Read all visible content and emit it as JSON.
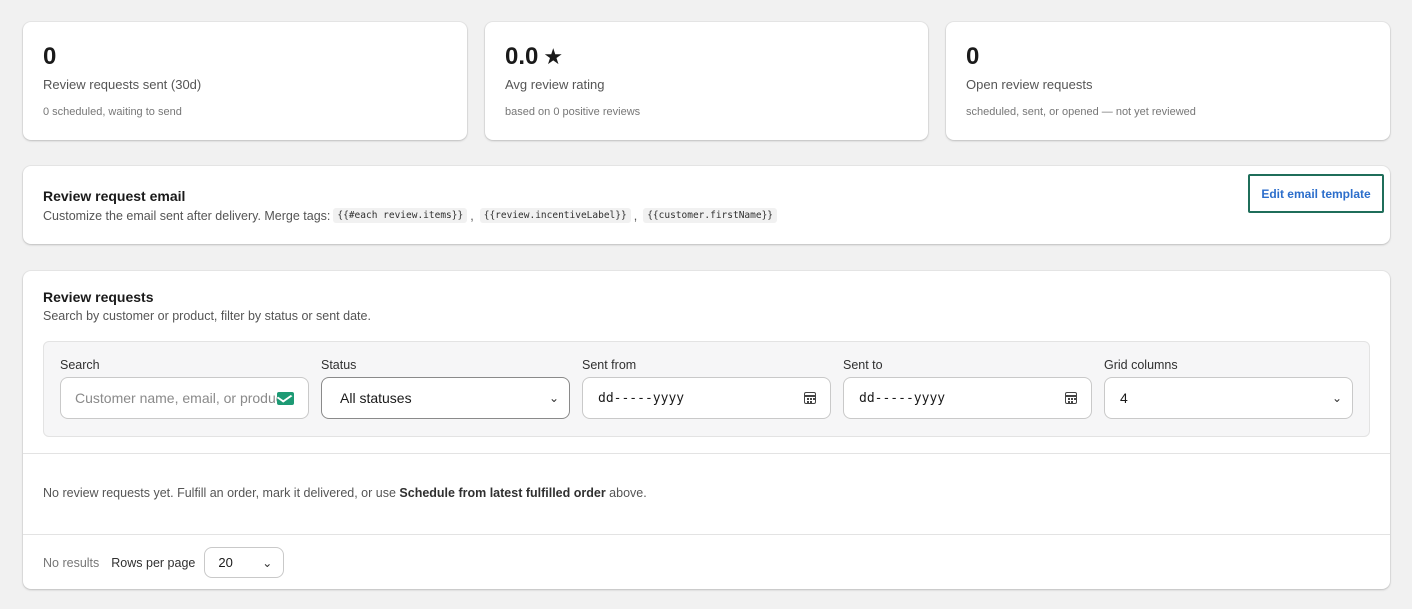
{
  "stats": [
    {
      "value": "0",
      "label": "Review requests sent (30d)",
      "sub": "0 scheduled, waiting to send"
    },
    {
      "value": "0.0",
      "label": "Avg review rating",
      "sub": "based on 0 positive reviews"
    },
    {
      "value": "0",
      "label": "Open review requests",
      "sub": "scheduled, sent, or opened — not yet reviewed"
    }
  ],
  "email": {
    "title": "Review request email",
    "desc": "Customize the email sent after delivery. Merge tags:",
    "tags": [
      "{{#each review.items}}",
      "{{review.incentiveLabel}}",
      "{{customer.firstName}}"
    ],
    "separator": ",",
    "edit_label": "Edit email template"
  },
  "requests": {
    "title": "Review requests",
    "desc": "Search by customer or product, filter by status or sent date.",
    "filters": {
      "search_label": "Search",
      "search_placeholder": "Customer name, email, or product",
      "status_label": "Status",
      "status_value": "All statuses",
      "sent_from_label": "Sent from",
      "sent_from_value": "dd-----yyyy",
      "sent_to_label": "Sent to",
      "sent_to_value": "dd-----yyyy",
      "grid_label": "Grid columns",
      "grid_value": "4"
    },
    "empty_pre": "No review requests yet. Fulfill an order, mark it delivered, or use ",
    "empty_bold": "Schedule from latest fulfilled order",
    "empty_post": " above.",
    "no_results": "No results",
    "rpp_label": "Rows per page",
    "rpp_value": "20"
  },
  "icons": {
    "star": "star-icon",
    "mail": "mail-icon",
    "calendar": "calendar-icon",
    "chevron": "chevron-down-icon"
  },
  "colors": {
    "accent": "#2c6ecb",
    "focus_border": "#1f6e5a",
    "mail_icon": "#1d9a74"
  }
}
